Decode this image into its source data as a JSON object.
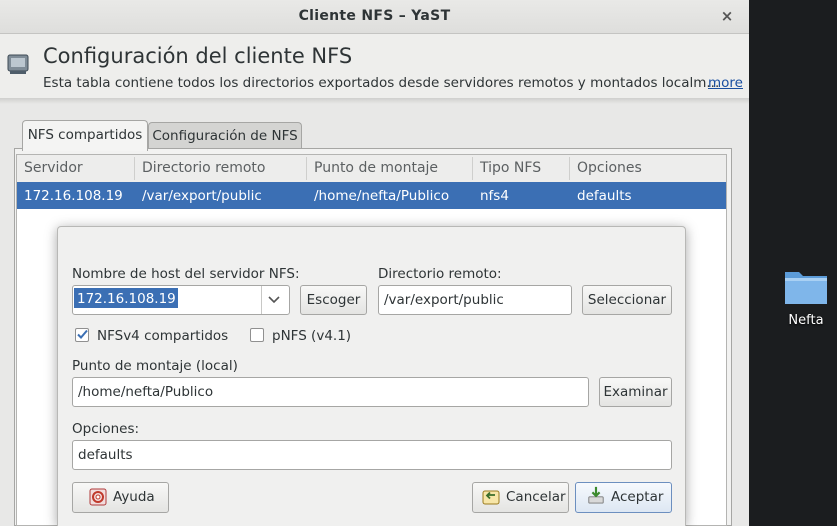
{
  "window": {
    "title": "Cliente NFS – YaST",
    "close_glyph": "×"
  },
  "header": {
    "icon": "nfs-drive-icon",
    "title": "Configuración del cliente NFS",
    "description": "Esta tabla contiene todos los directorios exportados desde servidores remotos y montados localm...",
    "more_link": "more"
  },
  "tabs": [
    {
      "label": "NFS compartidos",
      "active": true
    },
    {
      "label": "Configuración de NFS",
      "active": false
    }
  ],
  "table": {
    "columns": [
      "Servidor",
      "Directorio remoto",
      "Punto de montaje",
      "Tipo NFS",
      "Opciones"
    ],
    "rows": [
      [
        "172.16.108.19",
        "/var/export/public",
        "/home/nefta/Publico",
        "nfs4",
        "defaults"
      ]
    ]
  },
  "dialog": {
    "server_label": "Nombre de host del servidor NFS:",
    "server_value": "172.16.108.19",
    "choose_button": "Escoger",
    "remote_dir_label": "Directorio remoto:",
    "remote_dir_value": "/var/export/public",
    "select_button": "Seleccionar",
    "nfsv4_label": "NFSv4 compartidos",
    "nfsv4_checked": true,
    "pnfs_label": "pNFS (v4.1)",
    "pnfs_checked": false,
    "mount_label": "Punto de montaje (local)",
    "mount_value": "/home/nefta/Publico",
    "browse_button": "Examinar",
    "options_label": "Opciones:",
    "options_value": "defaults",
    "help_button": "Ayuda",
    "cancel_button": "Cancelar",
    "accept_button": "Aceptar"
  },
  "desktop": {
    "folder_label": "Nefta",
    "folder_icon": "folder-icon"
  },
  "colors": {
    "selection": "#3b6fb4",
    "link": "#1a4fa0"
  }
}
